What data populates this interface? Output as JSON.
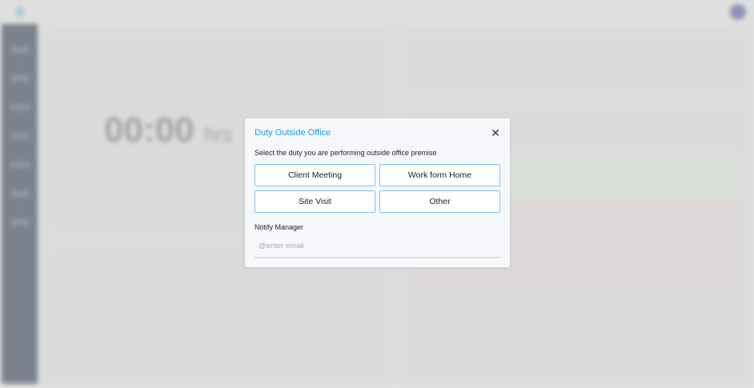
{
  "background": {
    "timer_value": "00:00",
    "timer_unit": "hrs"
  },
  "modal": {
    "title": "Duty Outside Office",
    "close_icon": "close-icon",
    "subtitle": "Select the duty you are performing outside office premise",
    "options": [
      {
        "label": "Client Meeting"
      },
      {
        "label": "Work form Home"
      },
      {
        "label": "Site Visit"
      },
      {
        "label": "Other"
      }
    ],
    "notify_label": "Notify Manager",
    "email_placeholder": "@enter email",
    "email_value": ""
  },
  "colors": {
    "accent": "#1b9be0",
    "option_border": "#7fc6ee",
    "sidebar": "#4b5566"
  }
}
